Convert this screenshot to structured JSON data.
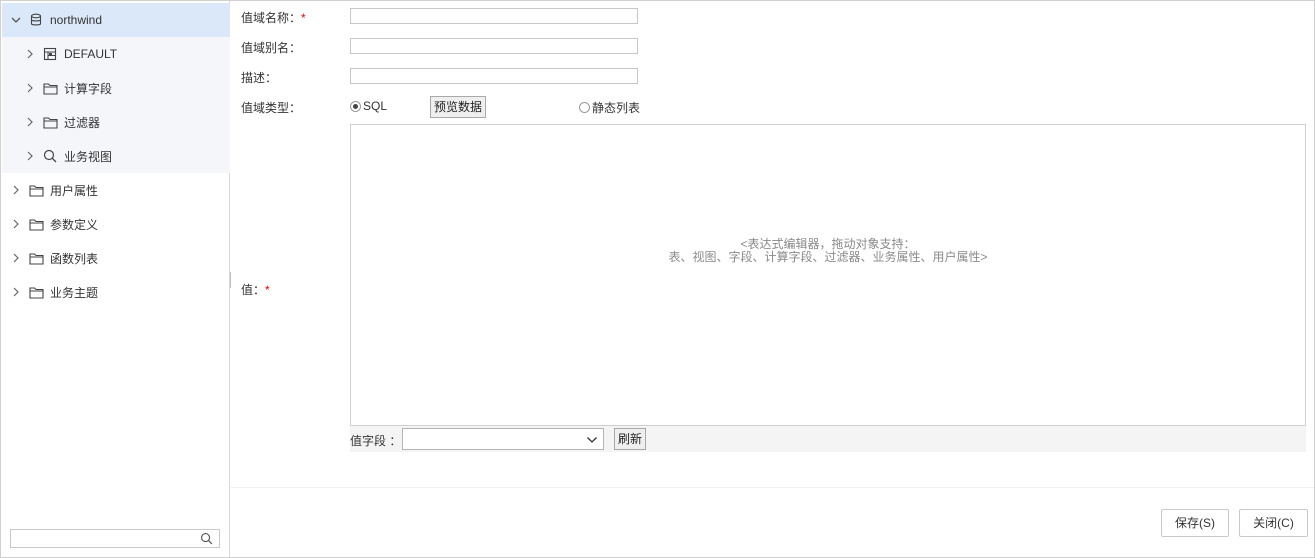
{
  "tree": {
    "root": {
      "label": "northwind",
      "icon": "database-icon"
    },
    "children": [
      {
        "label": "DEFAULT",
        "icon": "schema-icon"
      },
      {
        "label": "计算字段",
        "icon": "folder-icon"
      },
      {
        "label": "过滤器",
        "icon": "folder-icon"
      },
      {
        "label": "业务视图",
        "icon": "search-icon"
      }
    ],
    "top_items": [
      {
        "label": "用户属性",
        "icon": "folder-icon"
      },
      {
        "label": "参数定义",
        "icon": "folder-icon"
      },
      {
        "label": "函数列表",
        "icon": "folder-icon"
      },
      {
        "label": "业务主题",
        "icon": "folder-icon"
      }
    ],
    "search_placeholder": ""
  },
  "form": {
    "name_label": "值域名称：",
    "alias_label": "值域别名：",
    "desc_label": "描述：",
    "type_label": "值域类型：",
    "value_label": "值：",
    "required_mark": "*",
    "name_value": "",
    "alias_value": "",
    "desc_value": "",
    "type_options": [
      {
        "label": "SQL",
        "selected": true
      },
      {
        "label": "静态列表",
        "selected": false
      }
    ],
    "preview_button": "预览数据",
    "editor_placeholder_line1": "<表达式编辑器，拖动对象支持：",
    "editor_placeholder_line2": "表、视图、字段、计算字段、过滤器、业务属性、用户属性>",
    "value_field_label": "值字段 ：",
    "value_field_selected": "",
    "refresh_button": "刷新"
  },
  "footer": {
    "save_button": "保存(S)",
    "close_button": "关闭(C)"
  }
}
